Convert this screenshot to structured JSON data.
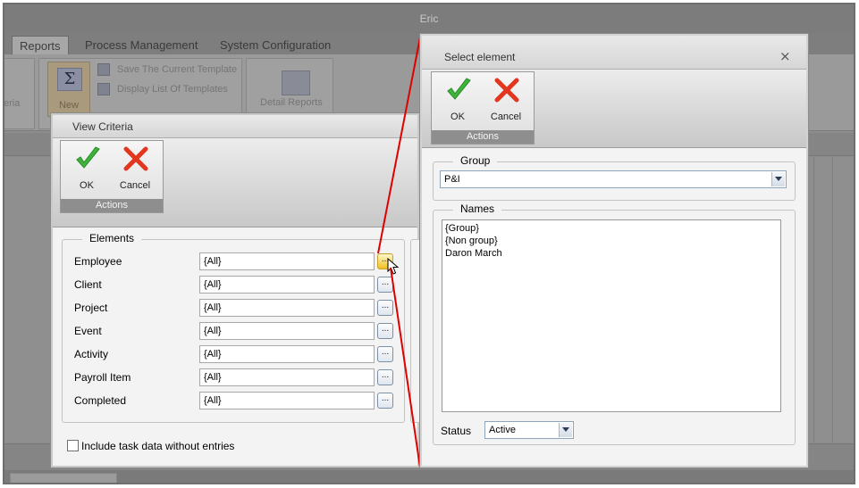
{
  "app": {
    "title": "Eric",
    "tabs": [
      {
        "label": "Reports",
        "active": true
      },
      {
        "label": "Process Management",
        "active": false
      },
      {
        "label": "System Configuration",
        "active": false
      }
    ],
    "ribbon": {
      "partial_label": "eria",
      "new_label": "New",
      "save_template": "Save The Current Template",
      "list_templates": "Display List Of Templates",
      "detail_reports": "Detail Reports"
    }
  },
  "view_criteria": {
    "title": "View Criteria",
    "actions": {
      "ok": "OK",
      "cancel": "Cancel",
      "group_label": "Actions"
    },
    "elements_legend": "Elements",
    "rows": [
      {
        "label": "Employee",
        "value": "{All}"
      },
      {
        "label": "Client",
        "value": "{All}"
      },
      {
        "label": "Project",
        "value": "{All}"
      },
      {
        "label": "Event",
        "value": "{All}"
      },
      {
        "label": "Activity",
        "value": "{All}"
      },
      {
        "label": "Payroll Item",
        "value": "{All}"
      },
      {
        "label": "Completed",
        "value": "{All}"
      }
    ],
    "browse_label": "...",
    "include_label": "Include task data without entries"
  },
  "select_element": {
    "title": "Select element",
    "close": "×",
    "actions": {
      "ok": "OK",
      "cancel": "Cancel",
      "group_label": "Actions"
    },
    "group_legend": "Group",
    "group_value": "P&I",
    "names_legend": "Names",
    "names": [
      "{Group}",
      "{Non group}",
      "Daron March"
    ],
    "status_label": "Status",
    "status_value": "Active"
  },
  "colors": {
    "ok_check": "#3fb43a",
    "cancel_x": "#e2361f",
    "callout_line": "#e00000",
    "cursor_highlight": "#f2c21b"
  }
}
